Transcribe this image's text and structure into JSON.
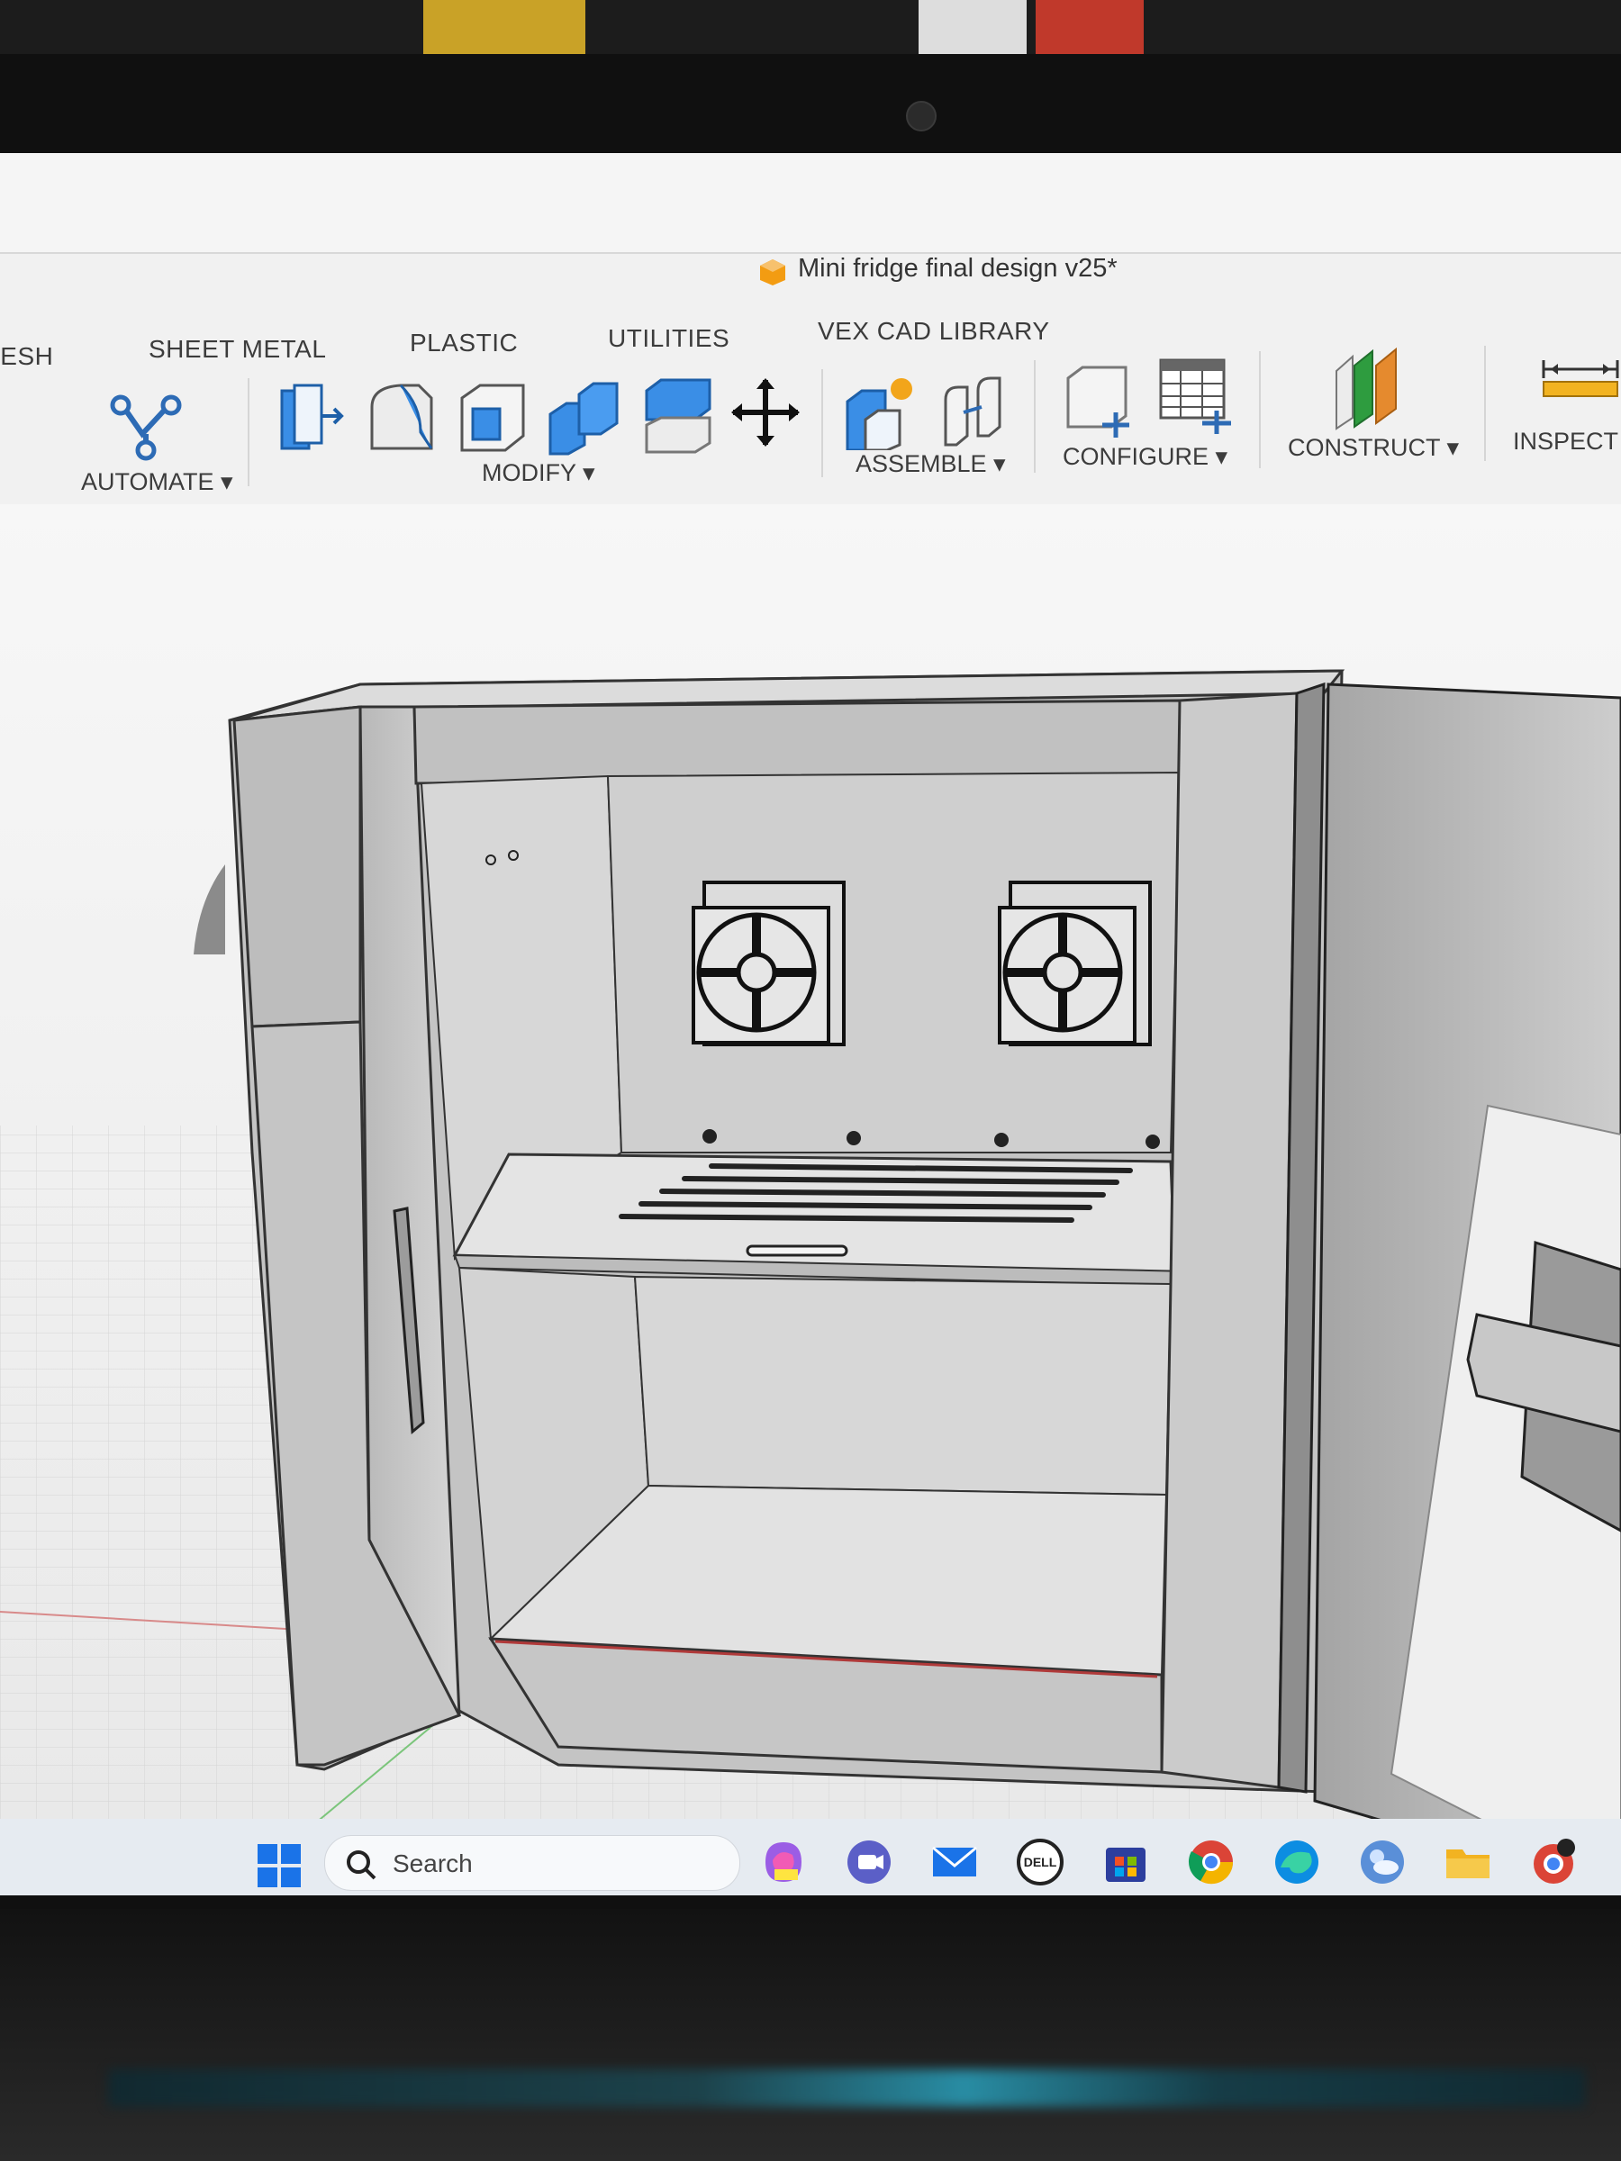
{
  "window": {
    "document_title": "Mini fridge final design v25*"
  },
  "tabs": [
    {
      "label": "MESH",
      "shown": "IESH"
    },
    {
      "label": "SHEET METAL"
    },
    {
      "label": "PLASTIC"
    },
    {
      "label": "UTILITIES"
    },
    {
      "label": "VEX CAD LIBRARY"
    }
  ],
  "ribbon_groups": {
    "automate": "AUTOMATE ▾",
    "modify": "MODIFY ▾",
    "assemble": "ASSEMBLE ▾",
    "configure": "CONFIGURE ▾",
    "construct": "CONSTRUCT ▾",
    "inspect": "INSPECT"
  },
  "colors": {
    "accent_blue": "#1e88e5",
    "construct_green": "#2e9c3f",
    "construct_orange": "#e58a2e",
    "model_gray": "#c9c9c9",
    "selection_yellow": "#f3e64a"
  },
  "taskbar": {
    "search_placeholder": "Search",
    "apps": [
      "windows-start",
      "copilot-pre",
      "teams",
      "mail",
      "dell",
      "store",
      "chrome",
      "edge",
      "weather",
      "file-explorer",
      "chrome-profile"
    ]
  }
}
